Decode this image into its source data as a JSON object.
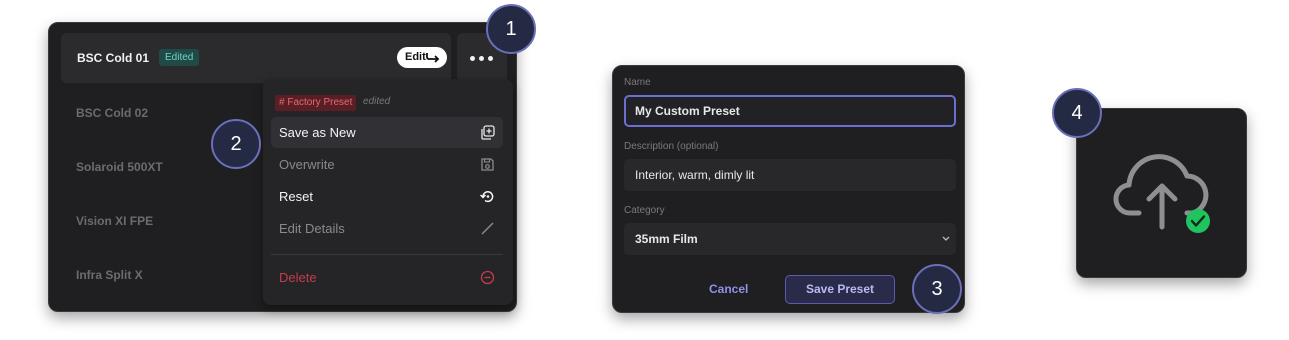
{
  "step_numbers": [
    "1",
    "2",
    "3",
    "4"
  ],
  "panel1": {
    "selected_preset": "BSC Cold 01",
    "edited_badge": "Edited",
    "edit_button": "Edit",
    "presets": [
      "BSC Cold 02",
      "Solaroid 500XT",
      "Vision XI FPE",
      "Infra Split X"
    ],
    "menu": {
      "factory_badge": "# Factory Preset",
      "factory_note": "edited",
      "items": [
        "Save as New",
        "Overwrite",
        "Reset",
        "Edit Details"
      ],
      "delete": "Delete"
    }
  },
  "panel2": {
    "name_label": "Name",
    "name_value": "My Custom Preset",
    "description_label": "Description (optional)",
    "description_value": "Interior, warm, dimly lit",
    "category_label": "Category",
    "category_value": "35mm Film",
    "cancel_label": "Cancel",
    "save_label": "Save Preset"
  },
  "panel3": {
    "icon": "cloud-upload-success-icon"
  },
  "colors": {
    "panel_bg": "#1f1f21",
    "accent": "#6b6fd0",
    "danger": "#c43c4a",
    "success": "#1fc45f",
    "edited_badge": "#6fd3c4"
  }
}
